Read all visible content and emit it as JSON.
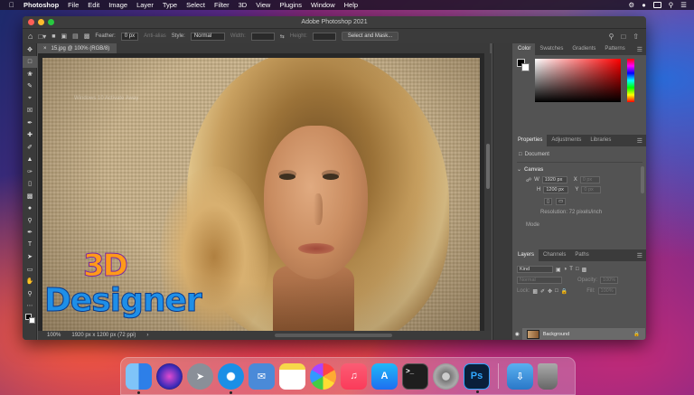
{
  "menubar": {
    "app": "Photoshop",
    "items": [
      "File",
      "Edit",
      "Image",
      "Layer",
      "Type",
      "Select",
      "Filter",
      "3D",
      "View",
      "Plugins",
      "Window",
      "Help"
    ]
  },
  "window": {
    "title": "Adobe Photoshop 2021",
    "colors": {
      "close": "#fe5f57",
      "minimize": "#febc2e",
      "maximize": "#28c840"
    }
  },
  "options_bar": {
    "feather_label": "Feather:",
    "feather_value": "0 px",
    "antialias_label": "Anti-alias",
    "style_label": "Style:",
    "style_value": "Normal",
    "width_label": "Width:",
    "height_label": "Height:",
    "select_mask_label": "Select and Mask..."
  },
  "document": {
    "tab_label": "15.jpg @ 100% (RGB/8)",
    "watermark_text": "Windows 10 Activate Away",
    "logo_top": "3D",
    "logo_bottom": "Designer",
    "zoom": "100%",
    "size_info": "1920 px x 1200 px (72 ppi)"
  },
  "color_panel": {
    "tabs": [
      "Color",
      "Swatches",
      "Gradients",
      "Patterns"
    ],
    "active_tab": 0
  },
  "properties_panel": {
    "tabs": [
      "Properties",
      "Adjustments",
      "Libraries"
    ],
    "active_tab": 0,
    "doc_label": "Document",
    "section": "Canvas",
    "w_label": "W",
    "w_value": "1920 px",
    "h_label": "H",
    "h_value": "1200 px",
    "x_label": "X",
    "x_value": "0 px",
    "y_label": "Y",
    "y_value": "0 px",
    "resolution": "Resolution: 72 pixels/inch",
    "mode_label": "Mode"
  },
  "layers_panel": {
    "tabs": [
      "Layers",
      "Channels",
      "Paths"
    ],
    "active_tab": 0,
    "kind_label": "Kind",
    "blend_mode": "Normal",
    "opacity_label": "Opacity:",
    "opacity_value": "100%",
    "lock_label": "Lock:",
    "fill_label": "Fill:",
    "fill_value": "100%",
    "layer_name": "Background"
  },
  "tools": [
    "move",
    "marquee",
    "lasso",
    "quick-select",
    "crop",
    "frame",
    "eyedropper",
    "healing",
    "brush",
    "stamp",
    "history-brush",
    "eraser",
    "gradient",
    "blur",
    "dodge",
    "pen",
    "type",
    "path-select",
    "rectangle",
    "hand",
    "zoom",
    "more"
  ],
  "dock": {
    "apps": [
      {
        "name": "finder",
        "color": "#2d7fe8"
      },
      {
        "name": "siri",
        "color": "#6a3ad8"
      },
      {
        "name": "launchpad",
        "color": "#8a8f98"
      },
      {
        "name": "safari",
        "color": "#1b8fe6"
      },
      {
        "name": "mail",
        "color": "#4a8ad8"
      },
      {
        "name": "notes",
        "color": "#f7d84a"
      },
      {
        "name": "photos",
        "color": "#f0f0f0"
      },
      {
        "name": "music",
        "color": "#fb3b5a"
      },
      {
        "name": "app-store",
        "color": "#1f8ef0"
      },
      {
        "name": "terminal",
        "color": "#1e1e1e"
      },
      {
        "name": "system-preferences",
        "color": "#8a8a8a"
      },
      {
        "name": "photoshop",
        "color": "#0a1f3a"
      }
    ],
    "ps_label": "Ps",
    "terminal_label": ">_"
  }
}
